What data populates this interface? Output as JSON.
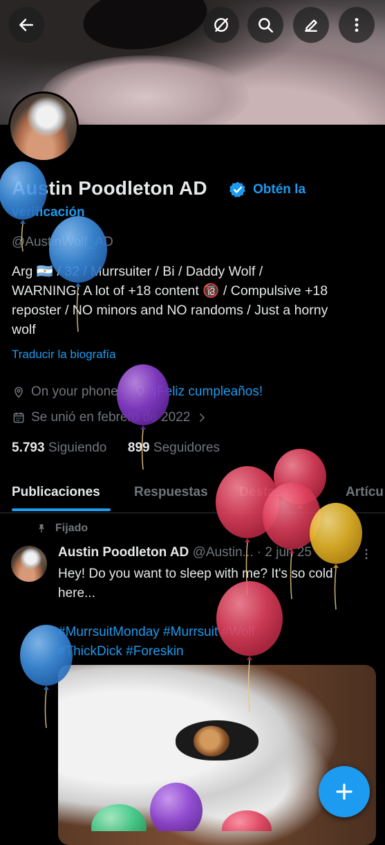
{
  "banner": {},
  "top_bar": {
    "back": "back-icon",
    "actions": [
      "grok-icon",
      "search-icon",
      "edit-icon",
      "more-icon"
    ]
  },
  "profile": {
    "name": "Austin Poodleton AD",
    "verify_cta_1": "Obtén la",
    "verify_cta_2": "verificación",
    "handle": "@AustinWolf_AD",
    "bio_1": "Arg 🇦🇷 / 32 / Murrsuiter / Bi / Daddy Wolf /",
    "bio_2": "WARNING: A lot of +18 content 🔞 / Compulsive +18",
    "bio_3": "reposter / NO minors and NO randoms / Just a horny",
    "bio_4": "wolf",
    "translate": "Traducir la biografía",
    "location": "On your phone",
    "birthday": "¡Feliz cumpleaños!",
    "joined": "Se unió en febrero de 2022",
    "following_count": "5.793",
    "following_label": "Siguiendo",
    "followers_count": "899",
    "followers_label": "Seguidores"
  },
  "tabs": [
    {
      "label": "Publicaciones",
      "active": true
    },
    {
      "label": "Respuestas",
      "active": false
    },
    {
      "label": "Destacados",
      "active": false
    },
    {
      "label": "Artícu",
      "active": false
    }
  ],
  "post": {
    "pinned_label": "Fijado",
    "author": "Austin Poodleton AD",
    "handle_trunc": "@Austin...",
    "date": "· 2 jun 25",
    "text_1": "Hey! Do you want to sleep with me? It's so cold",
    "text_2": "here...",
    "tags_1": "#MurrsuitMonday #Murrsuit #Wolf",
    "tags_2": "#ThickDick #Foreskin"
  },
  "fab": {
    "icon": "plus-icon"
  },
  "colors": {
    "accent": "#1d9bf0",
    "muted": "#71767b",
    "text": "#e7e9ea",
    "background": "#000000"
  }
}
